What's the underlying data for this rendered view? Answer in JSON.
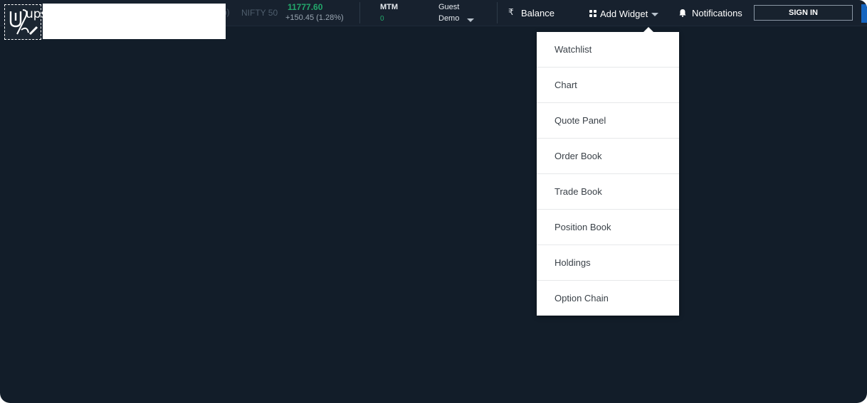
{
  "brand": {
    "logo_text": "ups",
    "logo_icon": "upstox-logo-icon"
  },
  "header": {
    "index": {
      "name": "NIFTY 50",
      "value": "11777.60",
      "change": "+150.45 (1.28%)",
      "partial_prev_change": "%)"
    },
    "mtm": {
      "label": "MTM",
      "value": "0"
    },
    "account": {
      "line1": "Guest",
      "line2": "Demo"
    },
    "balance": {
      "icon": "rupee-icon",
      "label": "Balance",
      "icon_glyph": "₹"
    },
    "add_widget": {
      "icon": "grid-icon",
      "label": "Add Widget"
    },
    "notifications": {
      "icon": "bell-icon",
      "label": "Notifications"
    },
    "sign_in": {
      "label": "SIGN IN"
    }
  },
  "widget_menu": {
    "items": [
      {
        "label": "Watchlist"
      },
      {
        "label": "Chart"
      },
      {
        "label": "Quote Panel"
      },
      {
        "label": "Order Book"
      },
      {
        "label": "Trade Book"
      },
      {
        "label": "Position Book"
      },
      {
        "label": "Holdings"
      },
      {
        "label": "Option Chain"
      }
    ]
  },
  "colors": {
    "background": "#121d29",
    "topbar": "#17212e",
    "positive": "#23a86b",
    "accent": "#1565c0"
  }
}
